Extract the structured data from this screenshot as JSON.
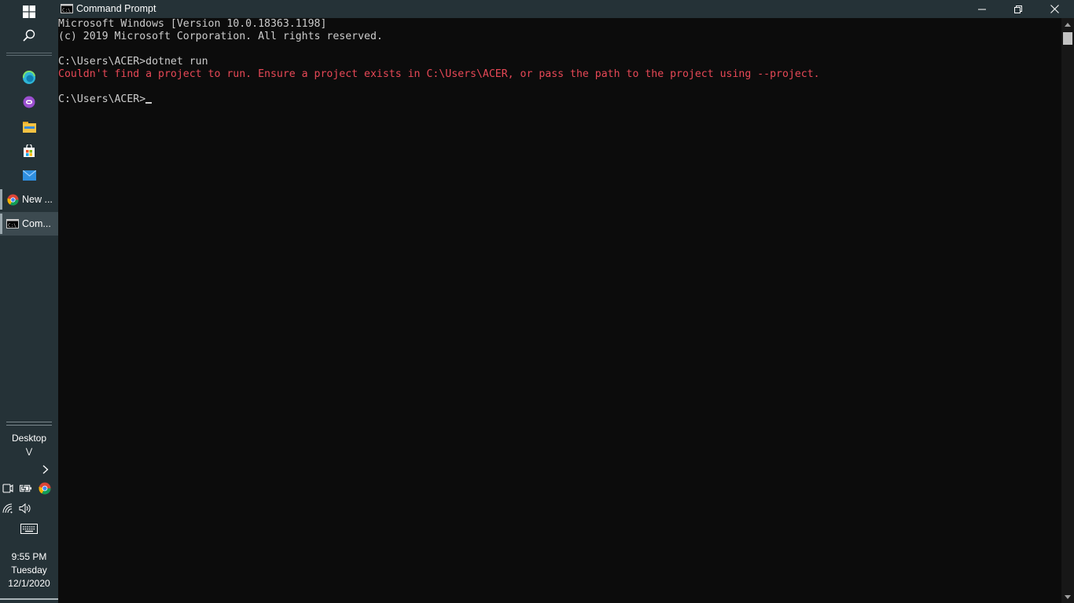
{
  "taskbar": {
    "start_icon": "windows-logo-icon",
    "search_icon": "search-icon",
    "pinned": [
      {
        "name": "edge-icon",
        "color": "#2fb5d6"
      },
      {
        "name": "podcast-icon",
        "color": "#9b4fd0"
      },
      {
        "name": "file-explorer-icon",
        "color": "#f5c242"
      },
      {
        "name": "store-icon",
        "color": "#ffffff"
      },
      {
        "name": "mail-icon",
        "color": "#2f8fe0"
      }
    ],
    "running": [
      {
        "label": "New ...",
        "icon": "chrome-icon",
        "active": false
      },
      {
        "label": "Com...",
        "icon": "cmd-icon",
        "active": true
      }
    ],
    "desktop_label": "Desktop",
    "tray_icons": [
      "meet-now-icon",
      "battery-icon",
      "chrome-tray-icon",
      "wifi-icon",
      "volume-icon",
      "touch-keyboard-icon"
    ],
    "clock": {
      "time": "9:55 PM",
      "day": "Tuesday",
      "date": "12/1/2020"
    }
  },
  "window": {
    "title": "Command Prompt",
    "controls": [
      "minimize",
      "restore",
      "close"
    ]
  },
  "console": {
    "lines": [
      {
        "text": "Microsoft Windows [Version 10.0.18363.1198]",
        "type": "normal"
      },
      {
        "text": "(c) 2019 Microsoft Corporation. All rights reserved.",
        "type": "normal"
      },
      {
        "text": "",
        "type": "normal"
      },
      {
        "text": "C:\\Users\\ACER>dotnet run",
        "type": "normal"
      },
      {
        "text": "Couldn't find a project to run. Ensure a project exists in C:\\Users\\ACER, or pass the path to the project using --project.",
        "type": "error"
      },
      {
        "text": "",
        "type": "normal"
      },
      {
        "text": "C:\\Users\\ACER>",
        "type": "prompt"
      }
    ]
  },
  "colors": {
    "taskbar_bg": "#253237",
    "console_bg": "#0c0c0c",
    "console_text": "#cccccc",
    "error_text": "#e74856"
  }
}
